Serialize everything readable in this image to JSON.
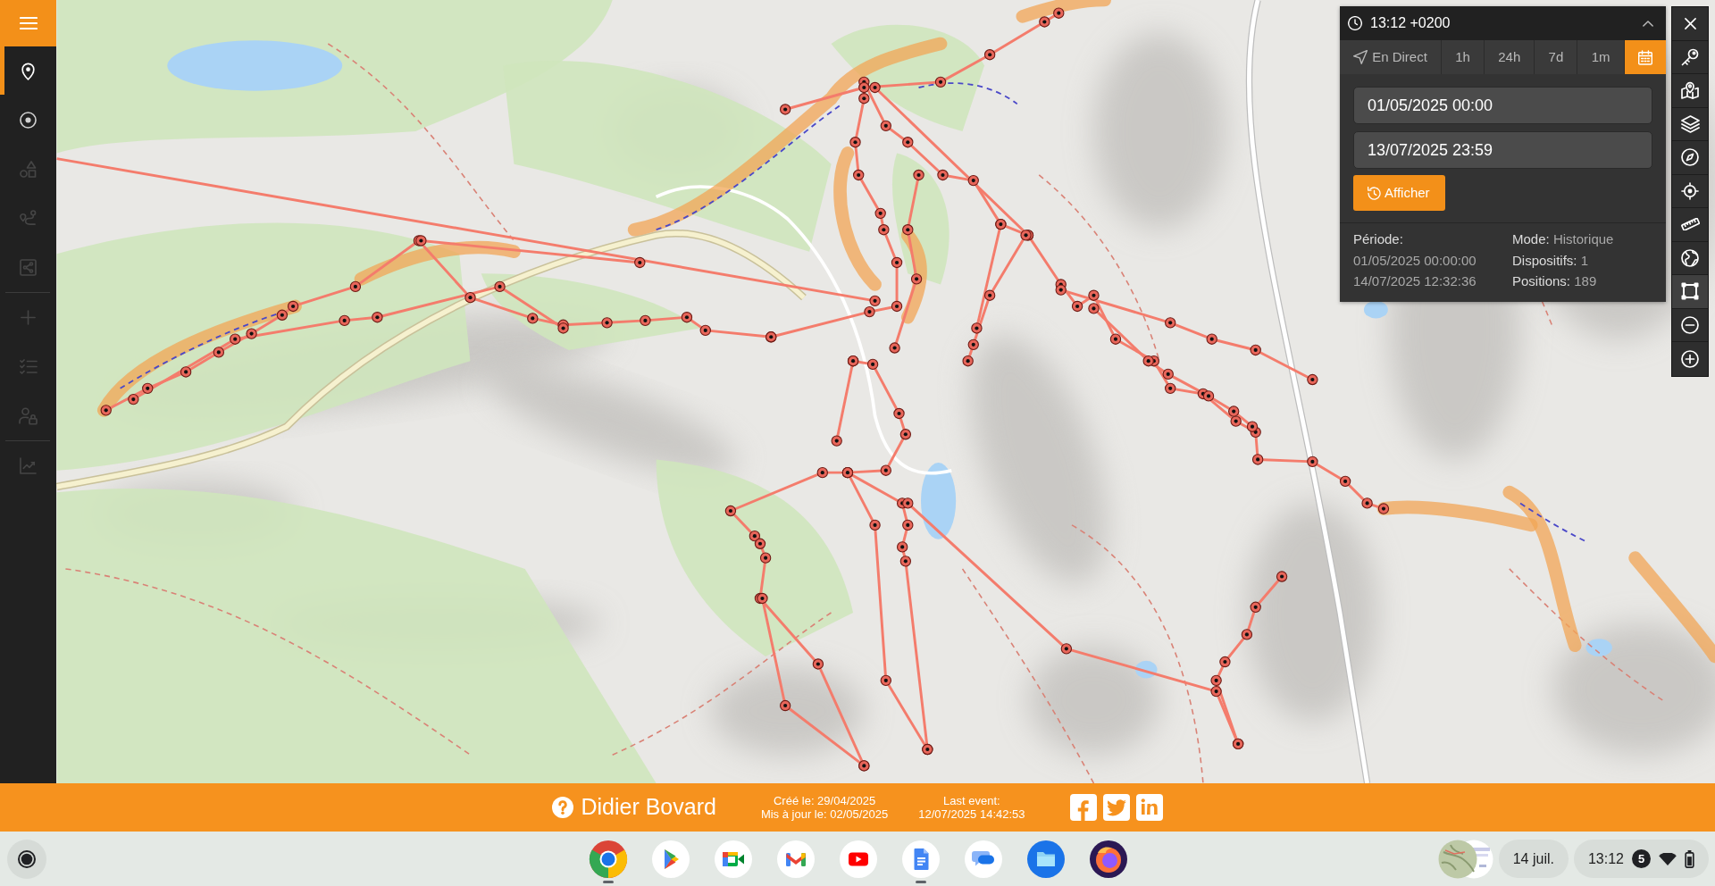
{
  "sidebar": {
    "sections": [
      {
        "items": [
          {
            "kind": "marker",
            "selected": true,
            "disabled": false
          },
          {
            "kind": "target",
            "selected": false,
            "disabled": false
          },
          {
            "kind": "shapes",
            "selected": false,
            "disabled": true
          },
          {
            "kind": "route",
            "selected": false,
            "disabled": true
          },
          {
            "kind": "share",
            "selected": false,
            "disabled": true
          }
        ]
      },
      {
        "items": [
          {
            "kind": "add",
            "selected": false,
            "disabled": true
          },
          {
            "kind": "checklist",
            "selected": false,
            "disabled": true
          },
          {
            "kind": "user-lock",
            "selected": false,
            "disabled": true
          }
        ]
      },
      {
        "items": [
          {
            "kind": "chart",
            "selected": false,
            "disabled": true
          }
        ]
      }
    ]
  },
  "time_panel": {
    "time": "13:12 +0200",
    "expanded": true,
    "tabs": [
      {
        "kind": "live",
        "label": "En Direct",
        "selected": false
      },
      {
        "kind": "range",
        "label": "1h",
        "selected": false
      },
      {
        "kind": "range",
        "label": "24h",
        "selected": false
      },
      {
        "kind": "range",
        "label": "7d",
        "selected": false
      },
      {
        "kind": "range",
        "label": "1m",
        "selected": false
      },
      {
        "kind": "calendar",
        "selected": true
      }
    ],
    "start": {
      "value": "01/05/2025 00:00"
    },
    "end": {
      "value": "13/07/2025 23:59"
    },
    "submit_button": "Afficher",
    "period": {
      "label": "Période:",
      "start": "01/05/2025 00:00:00",
      "end": "14/07/2025 12:32:36"
    },
    "stats": [
      {
        "label": "Mode:",
        "value": "Historique"
      },
      {
        "label": "Dispositifs:",
        "value": "1"
      },
      {
        "label": "Positions:",
        "value": "189"
      }
    ]
  },
  "map_tools": [
    {
      "kind": "close",
      "selected": false
    },
    {
      "kind": "key",
      "selected": false
    },
    {
      "kind": "map",
      "selected": false
    },
    {
      "kind": "layers",
      "selected": false
    },
    {
      "kind": "compass",
      "selected": false
    },
    {
      "kind": "locate",
      "selected": false
    },
    {
      "kind": "ruler",
      "selected": false
    },
    {
      "kind": "globe",
      "selected": false
    },
    {
      "kind": "select-area",
      "selected": true
    },
    {
      "kind": "zoom-out",
      "selected": false
    },
    {
      "kind": "zoom-in",
      "selected": false
    }
  ],
  "footer": {
    "name": "Didier Bovard",
    "created": "Créé le: 29/04/2025",
    "updated": "Mis à jour le: 02/05/2025",
    "last_event_label": "Last event:",
    "last_event": "12/07/2025 14:42:53",
    "social_links": [
      {
        "kind": "facebook"
      },
      {
        "kind": "twitter"
      },
      {
        "kind": "linkedin"
      }
    ]
  },
  "shelf": {
    "apps": [
      {
        "kind": "chrome",
        "running": true
      },
      {
        "kind": "play-store",
        "running": false
      },
      {
        "kind": "meet",
        "running": false
      },
      {
        "kind": "gmail",
        "running": false
      },
      {
        "kind": "youtube",
        "running": false
      },
      {
        "kind": "docs",
        "running": true
      },
      {
        "kind": "messages",
        "running": false
      },
      {
        "kind": "files",
        "running": false
      },
      {
        "kind": "firefox",
        "running": false
      }
    ],
    "date": "14 juil.",
    "time": "13:12",
    "notification_count": "5"
  }
}
